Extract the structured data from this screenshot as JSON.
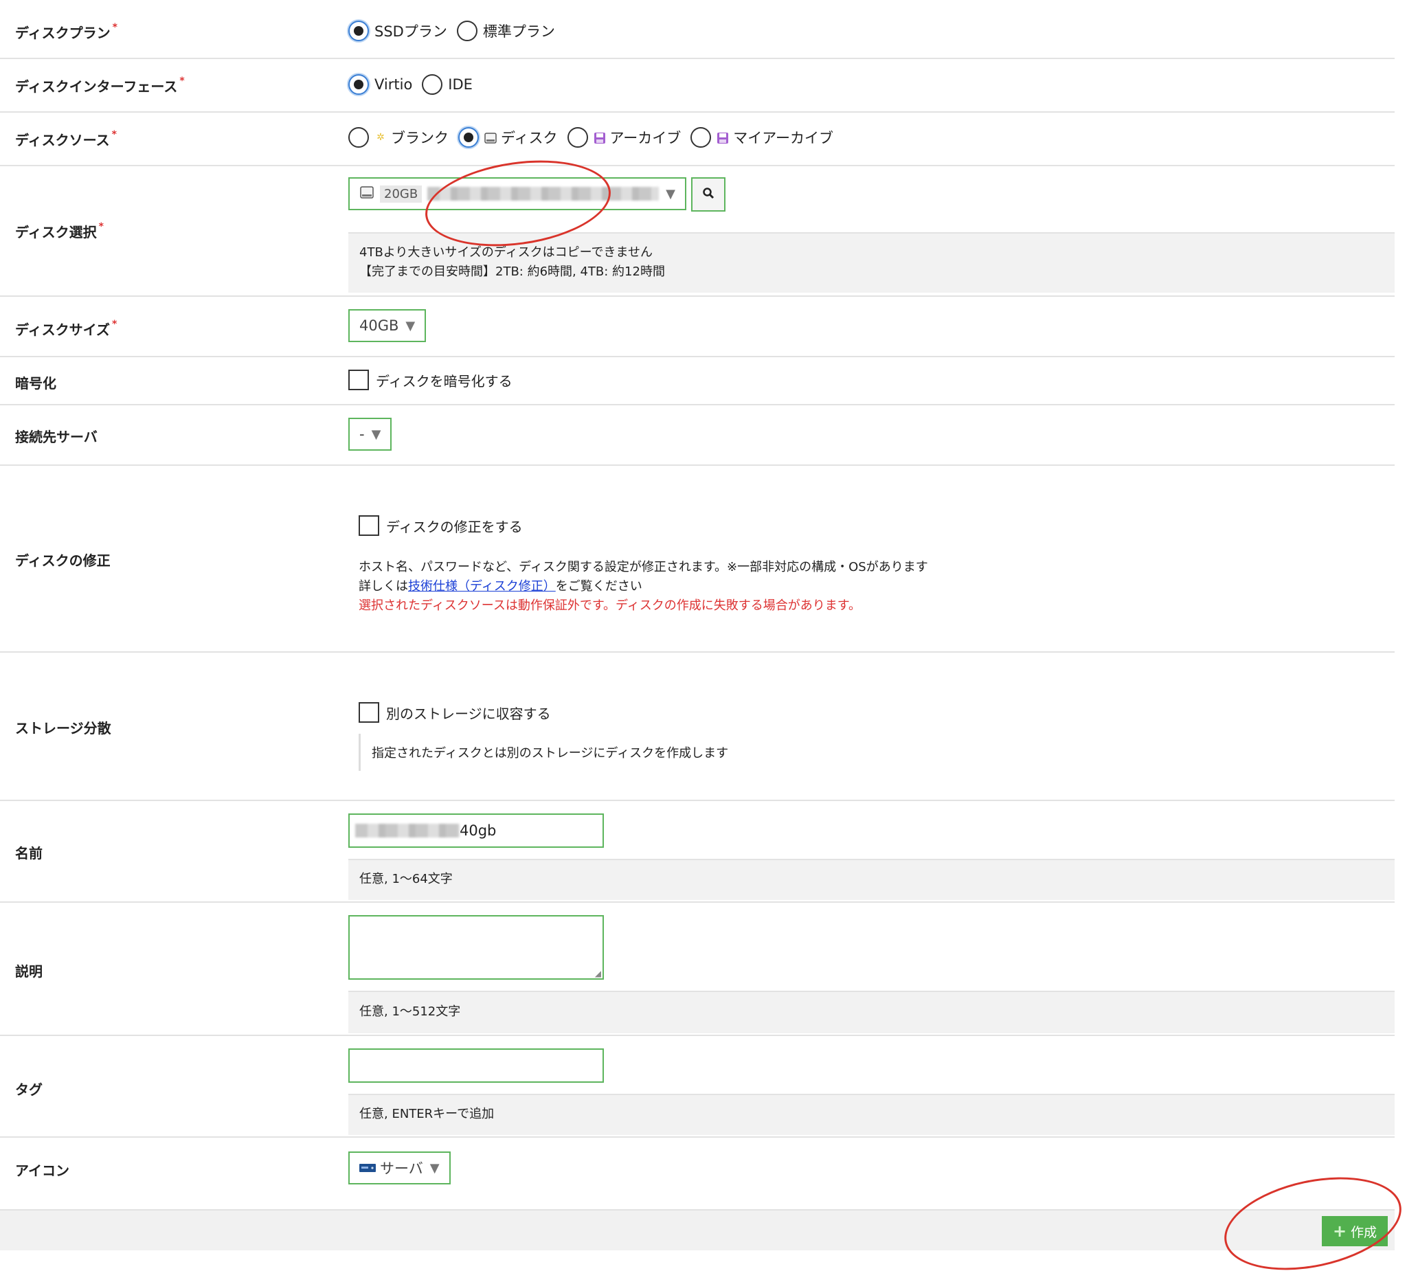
{
  "rows": {
    "plan": {
      "label": "ディスクプラン",
      "options": [
        "SSDプラン",
        "標準プラン"
      ],
      "selected": "SSDプラン"
    },
    "interface": {
      "label": "ディスクインターフェース",
      "options": [
        "Virtio",
        "IDE"
      ],
      "selected": "Virtio"
    },
    "source": {
      "label": "ディスクソース",
      "options": [
        "ブランク",
        "ディスク",
        "アーカイブ",
        "マイアーカイブ"
      ],
      "selected": "ディスク"
    },
    "disk_select": {
      "label": "ディスク選択",
      "size_badge": "20GB",
      "hint_line1": "4TBより大きいサイズのディスクはコピーできません",
      "hint_line2": "【完了までの目安時間】2TB: 約6時間, 4TB: 約12時間"
    },
    "disk_size": {
      "label": "ディスクサイズ",
      "value": "40GB"
    },
    "encryption": {
      "label": "暗号化",
      "checkbox_label": "ディスクを暗号化する",
      "checked": false
    },
    "server": {
      "label": "接続先サーバ",
      "value": "-"
    },
    "modify": {
      "label": "ディスクの修正",
      "checkbox_label": "ディスクの修正をする",
      "checked": false,
      "desc": "ホスト名、パスワードなど、ディスク関する設定が修正されます。※一部非対応の構成・OSがあります",
      "detail_prefix": "詳しくは",
      "detail_link": "技術仕様（ディスク修正）",
      "detail_suffix": "をご覧ください",
      "warning": "選択されたディスクソースは動作保証外です。ディスクの作成に失敗する場合があります。"
    },
    "storage": {
      "label": "ストレージ分散",
      "checkbox_label": "別のストレージに収容する",
      "checked": false,
      "note": "指定されたディスクとは別のストレージにディスクを作成します"
    },
    "name": {
      "label": "名前",
      "value_suffix": "40gb",
      "hint": "任意, 1〜64文字"
    },
    "description": {
      "label": "説明",
      "value": "",
      "hint": "任意, 1〜512文字"
    },
    "tags": {
      "label": "タグ",
      "value": "",
      "hint": "任意, ENTERキーで追加"
    },
    "icon": {
      "label": "アイコン",
      "value": "サーバ"
    }
  },
  "footer": {
    "create_label": "作成"
  },
  "colors": {
    "accent_green": "#52b04e",
    "field_border": "#5db55d",
    "required": "#d33333",
    "link": "#1a3fd6",
    "annotation": "#d9342b"
  }
}
